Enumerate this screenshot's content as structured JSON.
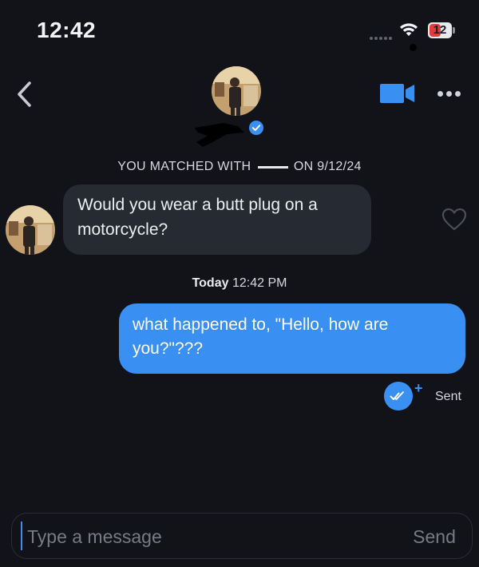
{
  "status_bar": {
    "time": "12:42",
    "battery_level": "12",
    "colors": {
      "battery_low": "#e23b3b"
    },
    "icons": [
      "wifi-icon",
      "battery-icon"
    ]
  },
  "header": {
    "icons": [
      "back-chevron-icon",
      "video-camera-icon",
      "more-dots-icon",
      "verified-badge-icon"
    ],
    "accent_color": "#3a8ff3"
  },
  "match_banner": {
    "prefix": "YOU MATCHED WITH",
    "suffix": "ON 9/12/24"
  },
  "messages": [
    {
      "direction": "incoming",
      "text": "Would you wear a butt plug on a motorcycle?",
      "liked": false
    },
    {
      "direction": "outgoing",
      "text": "what happened to, \"Hello, how are you?\"???",
      "status": "Sent"
    }
  ],
  "timestamp": {
    "day": "Today",
    "time": "12:42 PM"
  },
  "composer": {
    "placeholder": "Type a message",
    "value": "",
    "send_label": "Send"
  },
  "colors": {
    "background": "#111318",
    "incoming_bubble": "#262a33",
    "outgoing_bubble": "#3a8ff3"
  }
}
